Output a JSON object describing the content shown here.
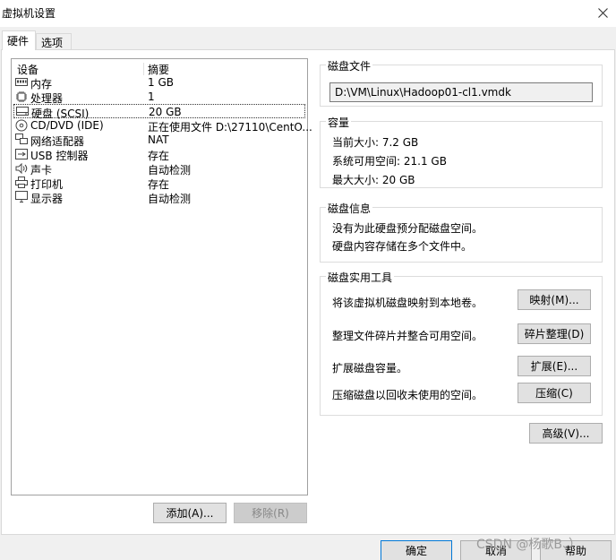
{
  "window": {
    "title": "虚拟机设置"
  },
  "tabs": [
    {
      "label": "硬件"
    },
    {
      "label": "选项"
    }
  ],
  "device_list": {
    "headers": {
      "device": "设备",
      "summary": "摘要"
    },
    "rows": [
      {
        "name": "内存",
        "value": "1 GB",
        "icon": "memory-icon"
      },
      {
        "name": "处理器",
        "value": "1",
        "icon": "cpu-icon"
      },
      {
        "name": "硬盘 (SCSI)",
        "value": "20 GB",
        "icon": "hard-disk-icon"
      },
      {
        "name": "CD/DVD (IDE)",
        "value": "正在使用文件 D:\\27110\\CentO...",
        "icon": "cd-dvd-icon"
      },
      {
        "name": "网络适配器",
        "value": "NAT",
        "icon": "network-icon"
      },
      {
        "name": "USB 控制器",
        "value": "存在",
        "icon": "usb-icon"
      },
      {
        "name": "声卡",
        "value": "自动检测",
        "icon": "sound-icon"
      },
      {
        "name": "打印机",
        "value": "存在",
        "icon": "printer-icon"
      },
      {
        "name": "显示器",
        "value": "自动检测",
        "icon": "display-icon"
      }
    ],
    "selected_index": 2
  },
  "buttons": {
    "add": "添加(A)...",
    "remove": "移除(R)",
    "ok": "确定",
    "cancel": "取消",
    "help": "帮助",
    "advanced": "高级(V)..."
  },
  "disk_file": {
    "title": "磁盘文件",
    "path": "D:\\VM\\Linux\\Hadoop01-cl1.vmdk"
  },
  "capacity": {
    "title": "容量",
    "current": "当前大小: 7.2 GB",
    "available": "系统可用空间: 21.1 GB",
    "max": "最大大小: 20 GB"
  },
  "disk_info": {
    "title": "磁盘信息",
    "line1": "没有为此硬盘预分配磁盘空间。",
    "line2": "硬盘内容存储在多个文件中。"
  },
  "utilities": {
    "title": "磁盘实用工具",
    "items": [
      {
        "text": "将该虚拟机磁盘映射到本地卷。",
        "button": "映射(M)..."
      },
      {
        "text": "整理文件碎片并整合可用空间。",
        "button": "碎片整理(D)"
      },
      {
        "text": "扩展磁盘容量。",
        "button": "扩展(E)..."
      },
      {
        "text": "压缩磁盘以回收未使用的空间。",
        "button": "压缩(C)"
      }
    ]
  },
  "watermark": "CSDN @杨歌B、）"
}
